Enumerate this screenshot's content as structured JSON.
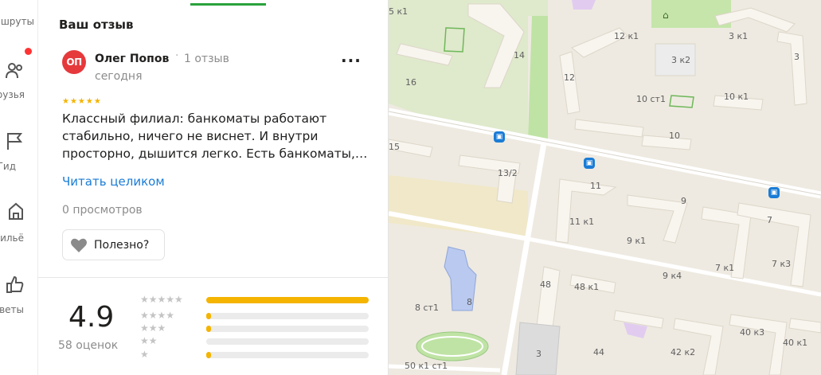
{
  "nav": {
    "items": [
      {
        "label": "шруты"
      },
      {
        "label": "рузья"
      },
      {
        "label": "Гид"
      },
      {
        "label": "ильё"
      },
      {
        "label": "веты"
      }
    ]
  },
  "review": {
    "section_title": "Ваш отзыв",
    "avatar_initials": "ОП",
    "author": "Олег Попов",
    "author_reviews": "1 отзыв",
    "date": "сегодня",
    "rating_stars": 5,
    "text": "Классный филиал: банкоматы работают стабильно, ничего не виснет. И внутри просторно, дышится легко. Есть банкоматы,…",
    "read_more": "Читать целиком",
    "views": "0 просмотров",
    "helpful_label": "Полезно?"
  },
  "rating_summary": {
    "value": "4.9",
    "count_label": "58 оценок",
    "distribution": [
      {
        "stars": 5,
        "fraction": 1.0
      },
      {
        "stars": 4,
        "fraction": 0.03
      },
      {
        "stars": 3,
        "fraction": 0.02
      },
      {
        "stars": 2,
        "fraction": 0.0
      },
      {
        "stars": 1,
        "fraction": 0.03
      }
    ]
  },
  "map": {
    "labels": [
      "5 к1",
      "16",
      "14",
      "12 к1",
      "3 к1",
      "3 к2",
      "3",
      "12",
      "10 ст1",
      "10 к1",
      "10",
      "15",
      "13/2",
      "11",
      "9",
      "7",
      "11 к1",
      "9 к1",
      "9 к4",
      "7 к1",
      "7 к3",
      "48",
      "48 к1",
      "8 ст1",
      "8",
      "3",
      "44",
      "42 к2",
      "40 к3",
      "40 к1",
      "50 к1 ст1"
    ]
  },
  "colors": {
    "accent_green": "#2aa23c",
    "star": "#f4b400",
    "link": "#1a7cd6",
    "avatar_bg": "#e6393c",
    "notification_dot": "#ff3333"
  }
}
